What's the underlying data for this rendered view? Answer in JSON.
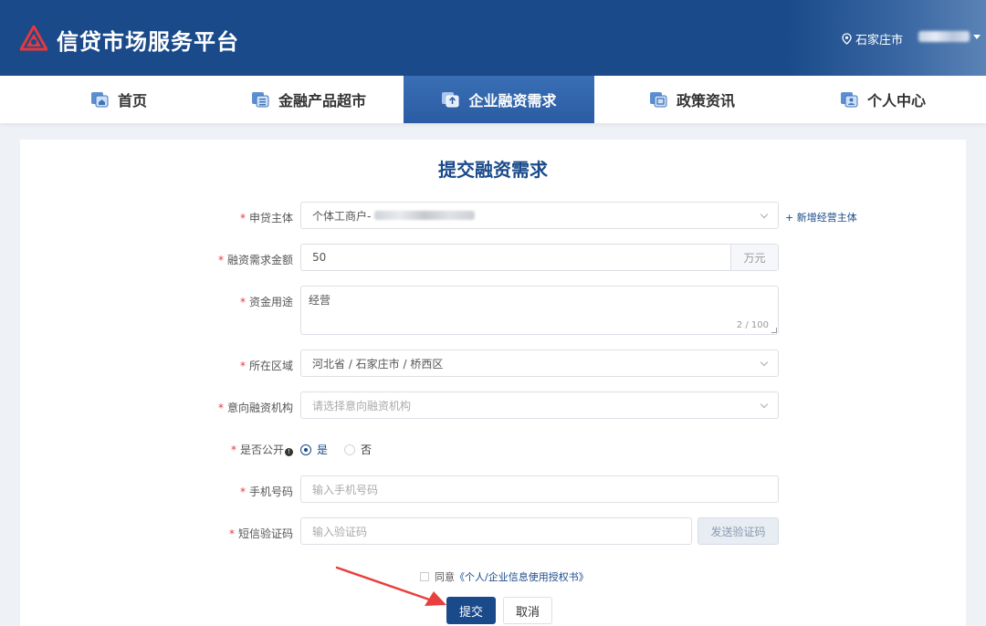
{
  "header": {
    "site_title": "信贷市场服务平台",
    "location": "石家庄市",
    "brand_color": "#1a4a8a"
  },
  "nav": {
    "items": [
      {
        "label": "首页",
        "icon": "home-icon"
      },
      {
        "label": "金融产品超市",
        "icon": "products-icon"
      },
      {
        "label": "企业融资需求",
        "icon": "financing-icon",
        "active": true
      },
      {
        "label": "政策资讯",
        "icon": "news-icon"
      },
      {
        "label": "个人中心",
        "icon": "user-center-icon"
      }
    ]
  },
  "form": {
    "title": "提交融资需求",
    "applicant": {
      "label": "申贷主体",
      "value": "个体工商户-",
      "add_link": "+ 新增经营主体"
    },
    "amount": {
      "label": "融资需求金额",
      "value": "50",
      "unit": "万元"
    },
    "purpose": {
      "label": "资金用途",
      "value": "经营",
      "counter": "2 / 100"
    },
    "region": {
      "label": "所在区域",
      "value": "河北省 / 石家庄市 / 桥西区"
    },
    "institution": {
      "label": "意向融资机构",
      "placeholder": "请选择意向融资机构"
    },
    "public": {
      "label": "是否公开",
      "info": "!",
      "yes": "是",
      "no": "否",
      "selected": "yes"
    },
    "phone": {
      "label": "手机号码",
      "placeholder": "输入手机号码"
    },
    "sms": {
      "label": "短信验证码",
      "placeholder": "输入验证码",
      "send_button": "发送验证码"
    },
    "required_mark": "*",
    "agreement": {
      "prefix": "同意",
      "link": "《个人/企业信息使用授权书》"
    },
    "submit": "提交",
    "cancel": "取消"
  },
  "colors": {
    "accent": "#1a4a8a",
    "required": "#e4393c",
    "annotation_arrow": "#e8403c"
  }
}
